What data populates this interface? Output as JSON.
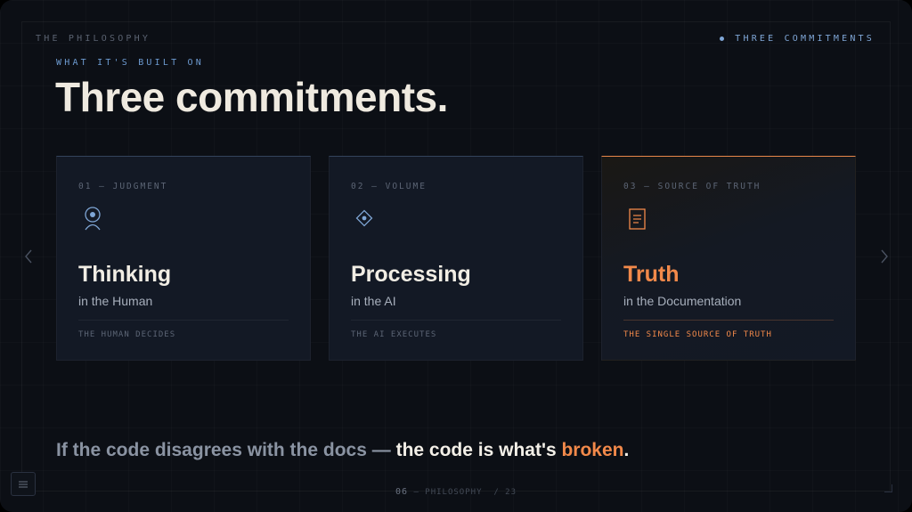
{
  "header": {
    "section_label": "THE PHILOSOPHY",
    "indicator_label": "THREE COMMITMENTS",
    "accent_color": "#7fa6d6"
  },
  "hero": {
    "eyebrow": "WHAT IT'S BUILT ON",
    "title": "Three commitments."
  },
  "cards": [
    {
      "number": "01 — JUDGMENT",
      "icon": "person-icon",
      "heading": "Thinking",
      "subheading": "in the Human",
      "footer": "THE HUMAN DECIDES"
    },
    {
      "number": "02 — VOLUME",
      "icon": "diamond-icon",
      "heading": "Processing",
      "subheading": "in the AI",
      "footer": "THE AI EXECUTES"
    },
    {
      "number": "03 — SOURCE OF TRUTH",
      "icon": "document-icon",
      "heading": "Truth",
      "subheading": "in the Documentation",
      "footer": "THE SINGLE SOURCE OF TRUTH",
      "highlight_color": "#f2894a"
    }
  ],
  "statement": {
    "lead": "If the code disagrees with the docs — ",
    "emphasis": "the code is what's ",
    "accent": "broken",
    "end": "."
  },
  "pager": {
    "current": "06",
    "separator": " — ",
    "section": "PHILOSOPHY",
    "total": "/ 23"
  }
}
